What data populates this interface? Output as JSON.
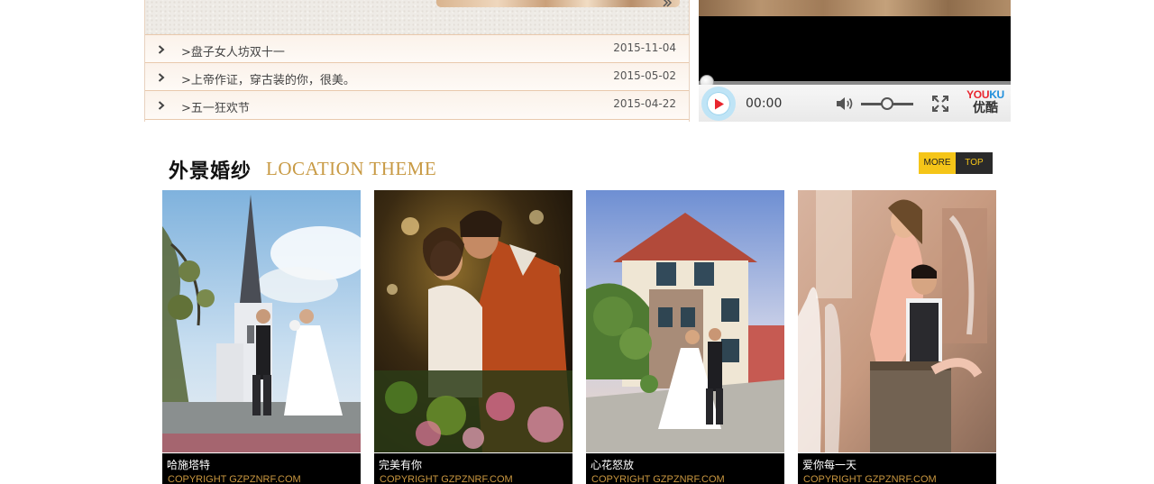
{
  "news": {
    "items": [
      {
        "title": ">盘子女人坊双十一",
        "date": "2015-11-04"
      },
      {
        "title": ">上帝作证，穿古装的你，很美。",
        "date": "2015-05-02"
      },
      {
        "title": ">五一狂欢节",
        "date": "2015-04-22"
      }
    ]
  },
  "player": {
    "time": "00:00",
    "brand_en_1": "YOU",
    "brand_en_2": "KU",
    "brand_cn": "优酷",
    "colors": {
      "play": "#e8252e",
      "ring": "#bfe4f6",
      "brand_red": "#e8252e",
      "brand_blue": "#1f8fdc"
    }
  },
  "section": {
    "title_cn": "外景婚纱",
    "title_en": "LOCATION THEME",
    "more_label": "MORE",
    "top_label": "TOP",
    "colors": {
      "accent": "#c89a44",
      "more_bg": "#f5c518",
      "top_bg": "#2a2a2a"
    }
  },
  "gallery": {
    "items": [
      {
        "title": "哈施塔特",
        "copyright": "COPYRIGHT GZPZNRF.COM"
      },
      {
        "title": "完美有你",
        "copyright": "COPYRIGHT GZPZNRF.COM"
      },
      {
        "title": "心花怒放",
        "copyright": "COPYRIGHT GZPZNRF.COM"
      },
      {
        "title": "爱你每一天",
        "copyright": "COPYRIGHT GZPZNRF.COM"
      }
    ]
  }
}
